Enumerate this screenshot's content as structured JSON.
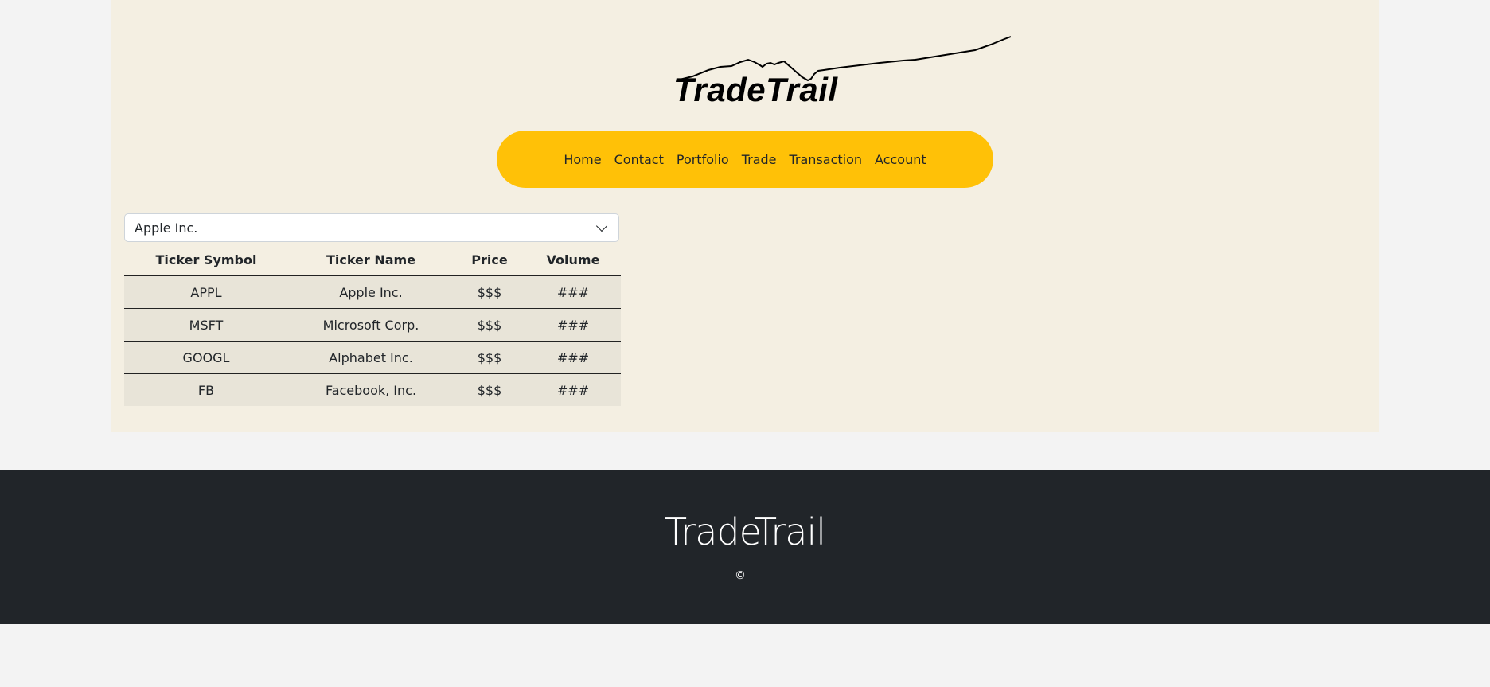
{
  "brand": {
    "logo_text": "TradeTrail"
  },
  "nav": {
    "items": [
      {
        "label": "Home"
      },
      {
        "label": "Contact"
      },
      {
        "label": "Portfolio"
      },
      {
        "label": "Trade"
      },
      {
        "label": "Transaction"
      },
      {
        "label": "Account"
      }
    ]
  },
  "stock_select": {
    "selected": "Apple Inc."
  },
  "table": {
    "headers": [
      "Ticker Symbol",
      "Ticker Name",
      "Price",
      "Volume"
    ],
    "rows": [
      [
        "APPL",
        "Apple Inc.",
        "$$$",
        "###"
      ],
      [
        "MSFT",
        "Microsoft Corp.",
        "$$$",
        "###"
      ],
      [
        "GOOGL",
        "Alphabet Inc.",
        "$$$",
        "###"
      ],
      [
        "FB",
        "Facebook, Inc.",
        "$$$",
        "###"
      ]
    ]
  },
  "footer": {
    "brand": "TradeTrail",
    "copyright": "©"
  },
  "colors": {
    "page_background": "#f3f3f3",
    "panel_background": "#f4efe2",
    "nav_background": "#ffc107",
    "row_background": "#e8e4d8",
    "footer_background": "#212529"
  },
  "icons": {
    "logo_graphic": "stock-trend-line-icon",
    "select_indicator": "chevron-down-icon"
  }
}
